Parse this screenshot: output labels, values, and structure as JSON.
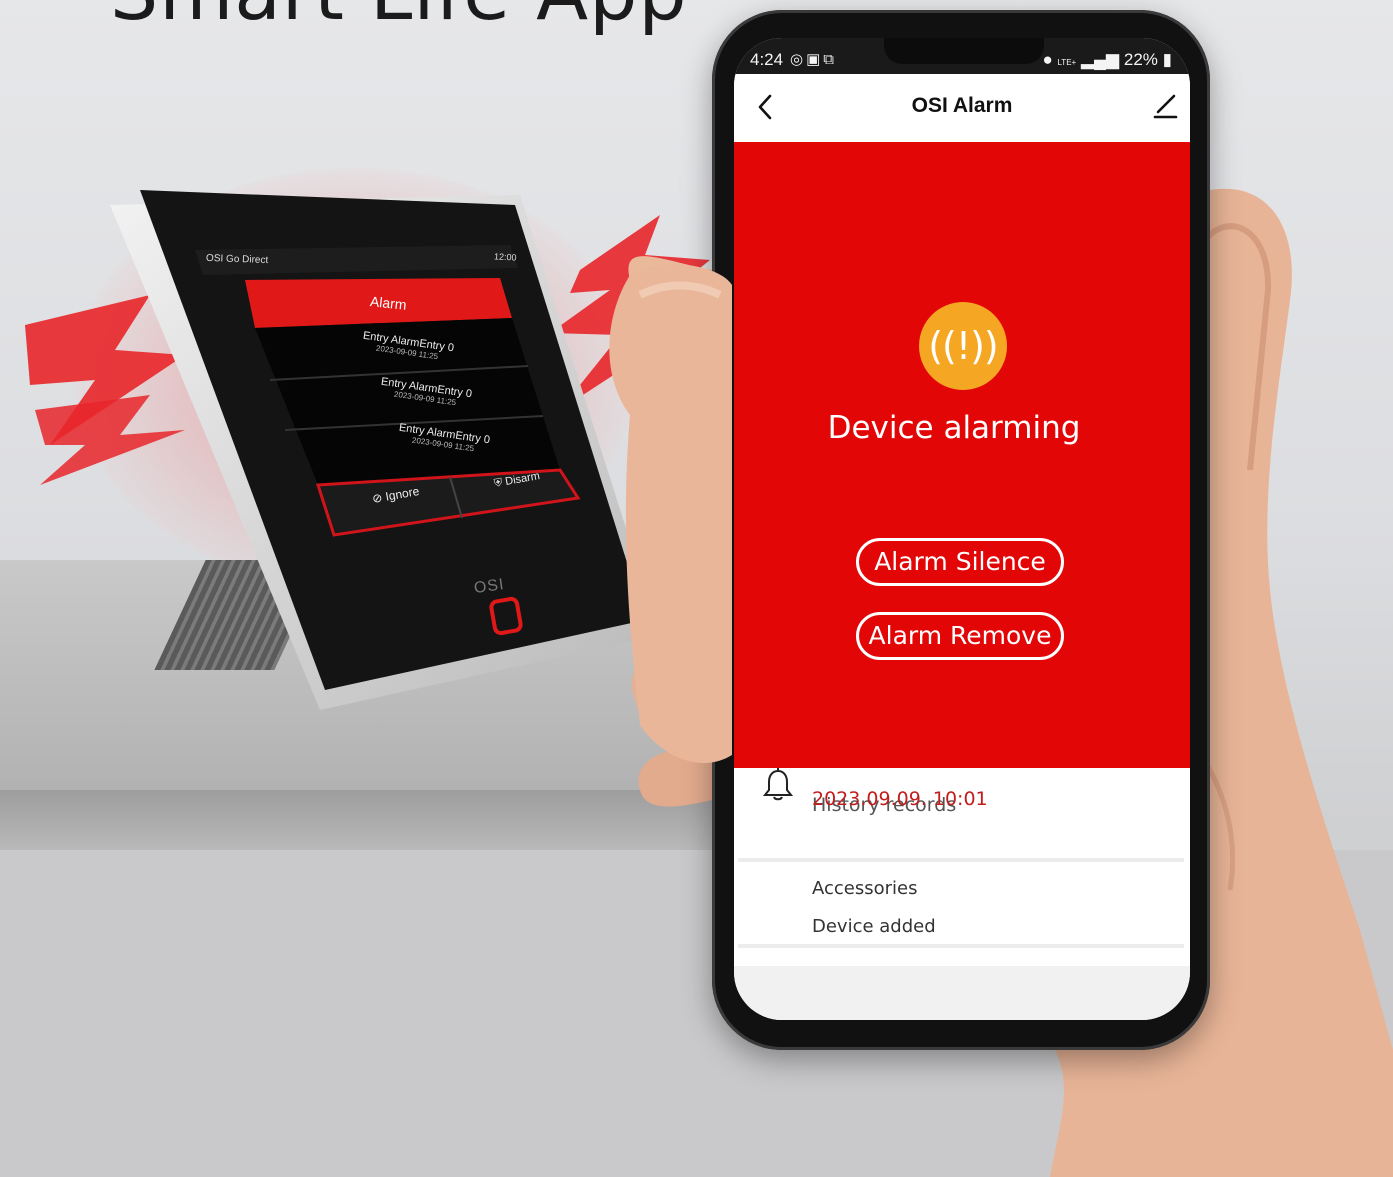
{
  "headline": "Smart Life App",
  "panel": {
    "brand": "OSI Go Direct",
    "clock": "12:00",
    "alarm_header": "Alarm",
    "entries": [
      {
        "title": "Entry AlarmEntry 0",
        "time": "2023-09-09 11:25"
      },
      {
        "title": "Entry AlarmEntry 0",
        "time": "2023-09-09 11:25"
      },
      {
        "title": "Entry AlarmEntry 0",
        "time": "2023-09-09 11:25"
      }
    ],
    "ignore_label": "Ignore",
    "disarm_label": "Disarm",
    "logo": "OSI"
  },
  "phone": {
    "status": {
      "time": "4:24",
      "battery": "22%",
      "network": "LTE+"
    },
    "appbar": {
      "title": "OSI Alarm"
    },
    "alarm": {
      "badge": "((!))",
      "status_text": "Device alarming",
      "silence_label": "Alarm Silence",
      "remove_label": "Alarm Remove"
    },
    "history": {
      "label": "History records",
      "timestamp": "2023.09.09. 10:01"
    },
    "accessories": {
      "title": "Accessories",
      "item": "Device added"
    }
  },
  "colors": {
    "alarm_red": "#e30606",
    "badge_orange": "#f5a623",
    "panel_black": "#141414",
    "timestamp_red": "#c21d1d"
  }
}
